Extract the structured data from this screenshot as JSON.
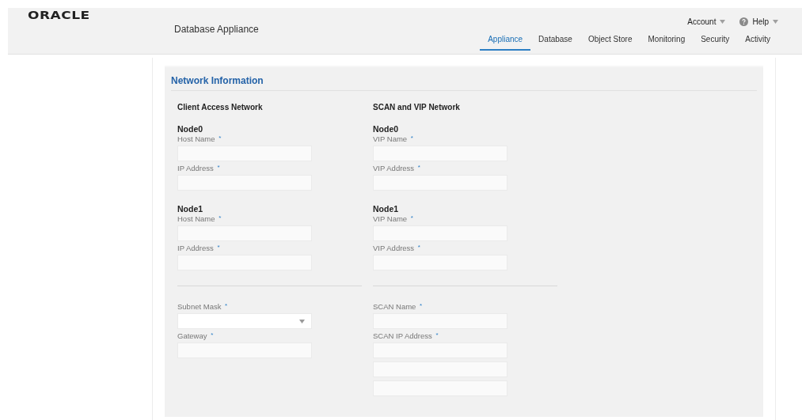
{
  "header": {
    "logo": "ORACLE",
    "app_title": "Database Appliance",
    "user_menu": [
      {
        "label": "Account",
        "kind": "menu"
      },
      {
        "label": "Help",
        "kind": "help"
      }
    ],
    "tabs": [
      {
        "label": "Appliance",
        "selected": true
      },
      {
        "label": "Database",
        "selected": false
      },
      {
        "label": "Object Store",
        "selected": false
      },
      {
        "label": "Monitoring",
        "selected": false
      },
      {
        "label": "Security",
        "selected": false
      },
      {
        "label": "Activity",
        "selected": false
      }
    ]
  },
  "section": {
    "title": "Network Information",
    "columns": [
      {
        "title": "Client Access Network",
        "nodes": [
          {
            "name": "Node0",
            "fields": [
              {
                "label": "Host Name",
                "required_mark": "*",
                "kind": "text"
              },
              {
                "label": "IP Address",
                "required_mark": "*",
                "kind": "text"
              }
            ]
          },
          {
            "name": "Node1",
            "fields": [
              {
                "label": "Host Name",
                "required_mark": "*",
                "kind": "text"
              },
              {
                "label": "IP Address",
                "required_mark": "*",
                "kind": "text"
              }
            ]
          }
        ],
        "shared_fields": [
          {
            "label": "Subnet Mask",
            "required_mark": "*",
            "kind": "select"
          },
          {
            "label": "Gateway",
            "required_mark": "*",
            "kind": "text"
          }
        ]
      },
      {
        "title": "SCAN and VIP Network",
        "nodes": [
          {
            "name": "Node0",
            "fields": [
              {
                "label": "VIP Name",
                "required_mark": "*",
                "kind": "text"
              },
              {
                "label": "VIP Address",
                "required_mark": "*",
                "kind": "text"
              }
            ]
          },
          {
            "name": "Node1",
            "fields": [
              {
                "label": "VIP Name",
                "required_mark": "*",
                "kind": "text"
              },
              {
                "label": "VIP Address",
                "required_mark": "*",
                "kind": "text"
              }
            ]
          }
        ],
        "shared_fields": [
          {
            "label": "SCAN Name",
            "required_mark": "*",
            "kind": "text"
          },
          {
            "label": "SCAN IP Address",
            "required_mark": "*",
            "kind": "text-triple"
          }
        ]
      }
    ]
  }
}
